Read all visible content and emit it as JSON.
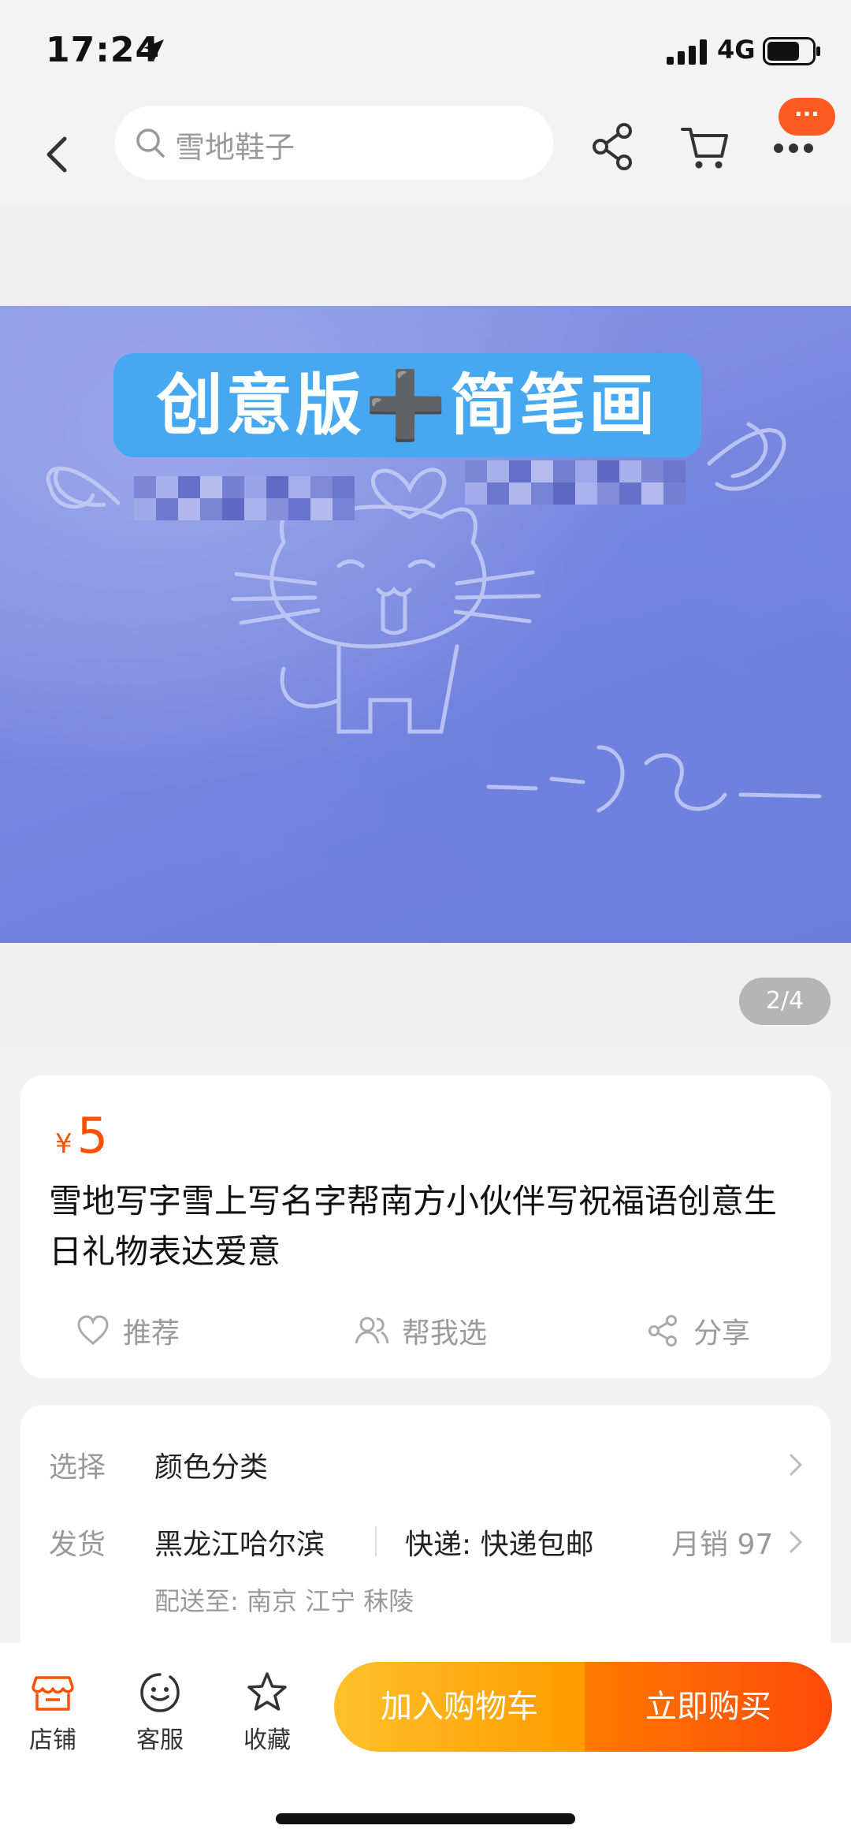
{
  "status_bar": {
    "time": "17:24",
    "network": "4G"
  },
  "nav": {
    "search_placeholder": "雪地鞋子",
    "badge": "···"
  },
  "gallery": {
    "banner_text": "创意版➕简笔画",
    "counter": "2/4"
  },
  "product": {
    "currency": "¥",
    "price": "5",
    "title": "雪地写字雪上写名字帮南方小伙伴写祝福语创意生日礼物表达爱意",
    "actions": {
      "recommend": "推荐",
      "help_choose": "帮我选",
      "share": "分享"
    }
  },
  "details": {
    "select_key": "选择",
    "select_value": "颜色分类",
    "ship_key": "发货",
    "ship_from": "黑龙江哈尔滨",
    "delivery": "快递: 快递包邮",
    "monthly_sales": "月销 97",
    "deliver_to": "配送至: 南京 江宁 秣陵"
  },
  "bottom_bar": {
    "store": "店铺",
    "service": "客服",
    "favorite": "收藏",
    "add_to_cart": "加入购物车",
    "buy_now": "立即购买"
  },
  "colors": {
    "accent": "#ff5000",
    "banner": "#46a8f0",
    "snow": "#7787df"
  }
}
